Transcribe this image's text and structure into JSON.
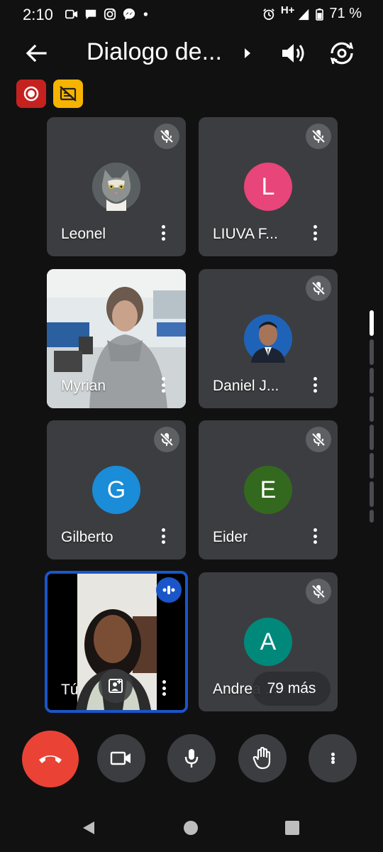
{
  "status_bar": {
    "time": "2:10",
    "network": "H+",
    "battery": "71 %"
  },
  "app_bar": {
    "title": "Dialogo de..."
  },
  "participants": [
    {
      "name": "Leonel",
      "muted": true,
      "avatar_type": "photo"
    },
    {
      "name": "LIUVA F...",
      "muted": true,
      "avatar_letter": "L",
      "avatar_color": "#e8457a"
    },
    {
      "name": "Myrian",
      "muted": false,
      "avatar_type": "video"
    },
    {
      "name": "Daniel J...",
      "muted": true,
      "avatar_type": "photo"
    },
    {
      "name": "Gilberto",
      "muted": true,
      "avatar_letter": "G",
      "avatar_color": "#1a8cd8"
    },
    {
      "name": "Eider",
      "muted": true,
      "avatar_letter": "E",
      "avatar_color": "#33691e"
    },
    {
      "name": "Tú",
      "muted": false,
      "avatar_type": "video",
      "speaking": true
    },
    {
      "name": "Andrea ...",
      "muted": true,
      "avatar_letter": "A",
      "avatar_color": "#00897b"
    }
  ],
  "more_participants": "79 más",
  "colors": {
    "background": "#111112",
    "tile": "#3c3d40",
    "hangup": "#ea4335",
    "speaking_border": "#1a56c9",
    "record_badge": "#c5221f",
    "captions_badge": "#f6b400"
  }
}
